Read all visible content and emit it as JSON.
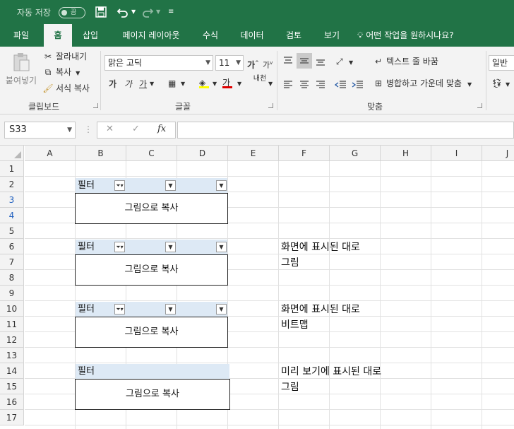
{
  "titlebar": {
    "autosave_label": "자동 저장",
    "autosave_toggle": "끔",
    "icons": [
      "save-icon",
      "undo-icon",
      "redo-icon",
      "customize-icon"
    ]
  },
  "tabs": [
    {
      "label": "파일"
    },
    {
      "label": "홈"
    },
    {
      "label": "삽입"
    },
    {
      "label": "페이지 레이아웃"
    },
    {
      "label": "수식"
    },
    {
      "label": "데이터"
    },
    {
      "label": "검토"
    },
    {
      "label": "보기"
    }
  ],
  "tell_me": "어떤 작업을 원하시나요?",
  "clipboard": {
    "paste": "붙여넣기",
    "cut": "잘라내기",
    "copy": "복사",
    "format_painter": "서식 복사",
    "group": "클립보드"
  },
  "font": {
    "name": "맑은 고딕",
    "size": "11",
    "group": "글꼴",
    "bold": "가",
    "italic": "가",
    "underline": "가",
    "grow": "가",
    "shrink": "가",
    "color_glyph": "가",
    "phonetic": "내천"
  },
  "alignment": {
    "wrap_text": "텍스트 줄 바꿈",
    "merge_center": "병합하고 가운데 맞춤",
    "group": "맞춤"
  },
  "number": {
    "format": "일반"
  },
  "formula_bar": {
    "name_box": "S33",
    "fx": "fx",
    "cancel": "✕",
    "enter": "✓"
  },
  "grid": {
    "columns": [
      "A",
      "B",
      "C",
      "D",
      "E",
      "F",
      "G",
      "H",
      "I",
      "J"
    ],
    "rows": [
      "1",
      "2",
      "3",
      "4",
      "5",
      "6",
      "7",
      "8",
      "9",
      "10",
      "11",
      "12",
      "13",
      "14",
      "15",
      "16",
      "17"
    ],
    "selected_rows": [
      "3",
      "4"
    ]
  },
  "blocks": [
    {
      "filter_label": "필터",
      "picture_text": "그림으로 복사"
    },
    {
      "filter_label": "필터",
      "picture_text": "그림으로 복사"
    },
    {
      "filter_label": "필터",
      "picture_text": "그림으로 복사"
    },
    {
      "filter_label": "필터",
      "picture_text": "그림으로 복사"
    }
  ],
  "notes": [
    {
      "line1": "화면에 표시된 대로",
      "line2": "그림"
    },
    {
      "line1": "화면에 표시된 대로",
      "line2": "비트맵"
    },
    {
      "line1": "미리 보기에 표시된 대로",
      "line2": "그림"
    }
  ]
}
